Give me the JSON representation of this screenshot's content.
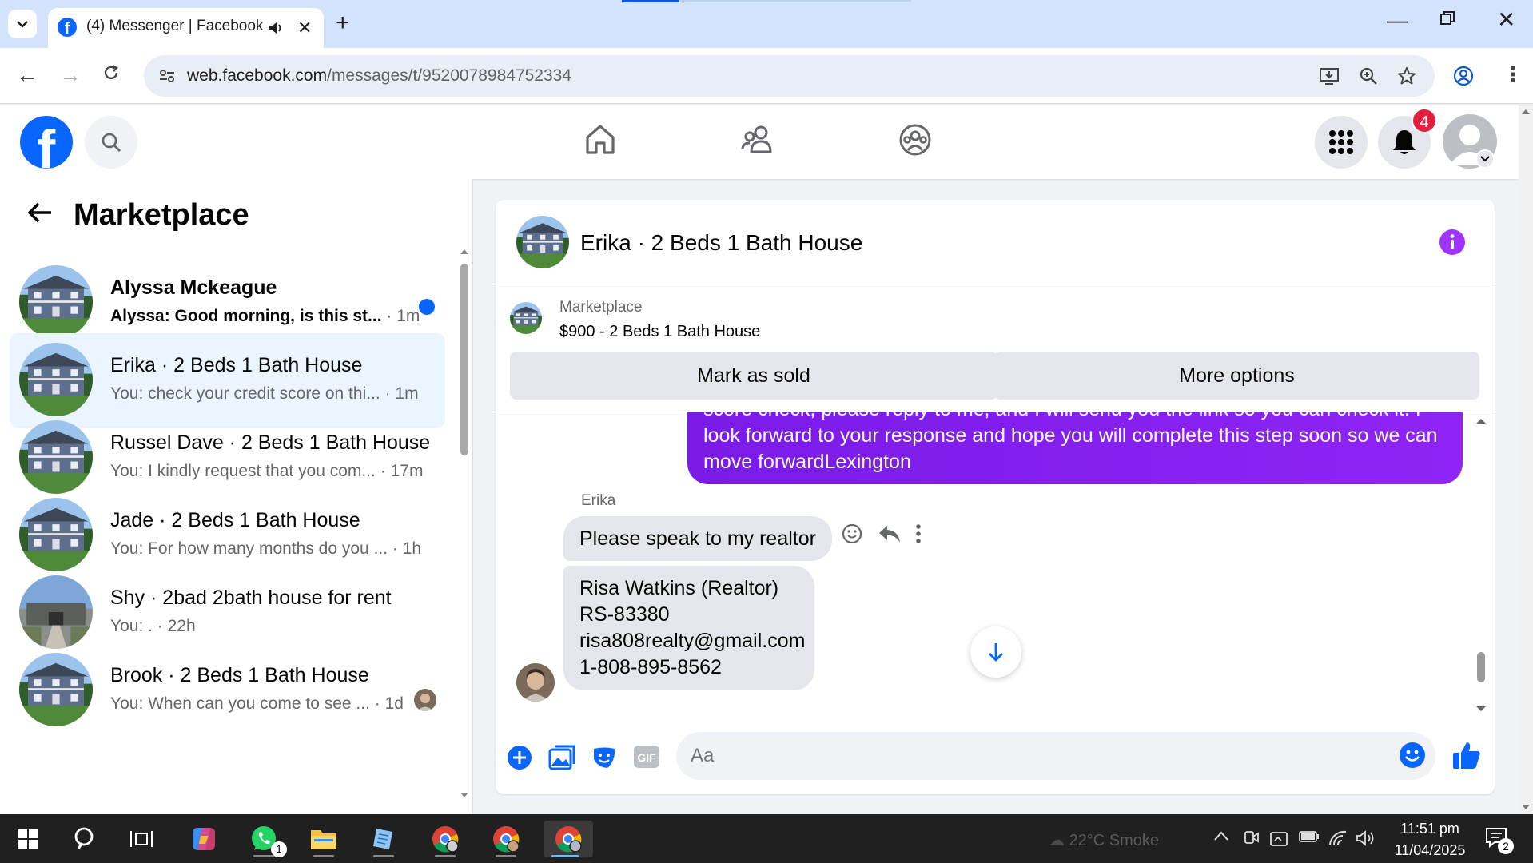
{
  "browser": {
    "tab_title": "(4) Messenger | Facebook",
    "url_host": "web.facebook.com",
    "url_path": "/messages/t/9520078984752334"
  },
  "facebook": {
    "notification_count": "4"
  },
  "sidebar": {
    "title": "Marketplace",
    "conversations": [
      {
        "name": "Alyssa Mckeague",
        "snippet": "Alyssa: Good morning, is this st...",
        "time": " · 1m",
        "unread": true
      },
      {
        "name": "Erika · 2 Beds 1 Bath House",
        "snippet": "You: check your credit score on thi...",
        "time": " · 1m",
        "active": true
      },
      {
        "name": "Russel Dave · 2 Beds 1 Bath House",
        "snippet": "You: I kindly request that you com...",
        "time": " · 17m"
      },
      {
        "name": "Jade · 2 Beds 1 Bath House",
        "snippet": "You: For how many months do you ...",
        "time": " · 1h"
      },
      {
        "name": "Shy · 2bad 2bath house for rent",
        "snippet": "You: .",
        "time": " · 22h"
      },
      {
        "name": "Brook · 2 Beds 1 Bath House",
        "snippet": "You: When can you come to see ...",
        "time": " · 1d"
      }
    ]
  },
  "chat": {
    "title": "Erika · 2 Beds 1 Bath House",
    "listing_label": "Marketplace",
    "listing_price": "$900 - 2 Beds 1 Bath House",
    "mark_sold_label": "Mark as sold",
    "more_options_label": "More options",
    "outgoing_message": "score check, please reply to me, and I will send you the link so you can check it. I look forward to your response and hope you will complete this step soon so we can move forwardLexington",
    "sender_name": "Erika",
    "incoming_1": "Please speak to my realtor",
    "incoming_2_lines": [
      "Risa Watkins (Realtor)",
      "RS-83380",
      "risa808realty@gmail.com",
      "1-808-895-8562"
    ],
    "input_placeholder": "Aa"
  },
  "taskbar": {
    "weather": "22°C  Smoke",
    "time": "11:51 pm",
    "date": "11/04/2025",
    "notification_count": "2",
    "whatsapp_badge": "1"
  },
  "colors": {
    "fb_blue": "#0866ff",
    "messenger_purple": "#8a2be2",
    "notif_red": "#e41e3f",
    "active_row": "#ebf5ff"
  }
}
